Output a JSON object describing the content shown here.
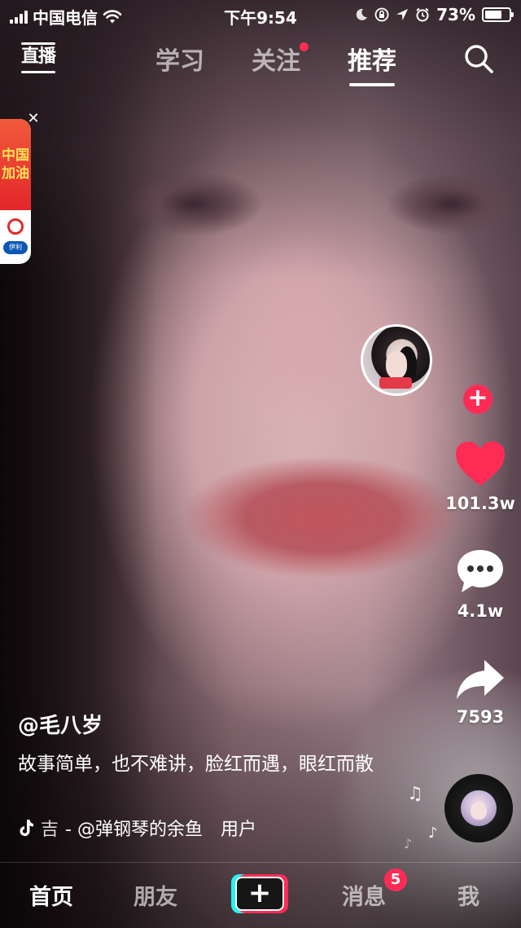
{
  "status_bar": {
    "carrier": "中国电信",
    "time": "下午9:54",
    "battery": "73%",
    "battery_level": 0.73
  },
  "top_nav": {
    "live_label": "直播",
    "tabs": [
      {
        "label": "学习",
        "active": false,
        "dot": false
      },
      {
        "label": "关注",
        "active": false,
        "dot": true
      },
      {
        "label": "推荐",
        "active": true,
        "dot": false
      }
    ],
    "search_icon": "search-icon"
  },
  "promo": {
    "line1": "中国",
    "line2": "加油",
    "brand": "伊利",
    "close_icon": "close-icon"
  },
  "rail": {
    "like_count": "101.3w",
    "comment_count": "4.1w",
    "share_count": "7593"
  },
  "caption": {
    "author": "@毛八岁",
    "description": "故事简单，也不难讲，脸红而遇，眼红而散",
    "music_prefix": "吉",
    "music": "- @弹钢琴的余鱼　用户"
  },
  "bottom_nav": {
    "home": "首页",
    "friends": "朋友",
    "create": "+",
    "inbox": "消息",
    "inbox_badge": "5",
    "me": "我"
  },
  "colors": {
    "accent": "#fe2c55",
    "cyan": "#25f4ee",
    "brand_blue": "#0a57b5"
  }
}
